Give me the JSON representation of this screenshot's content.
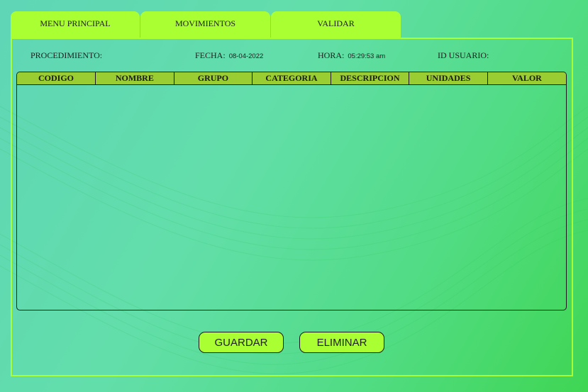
{
  "tabs": [
    {
      "label": "MENU PRINCIPAL"
    },
    {
      "label": "MOVIMIENTOS"
    },
    {
      "label": "VALIDAR"
    }
  ],
  "header_fields": {
    "procedimiento": {
      "label": "PROCEDIMIENTO:",
      "value": ""
    },
    "fecha": {
      "label": "FECHA:",
      "value": "08-04-2022"
    },
    "hora": {
      "label": "HORA:",
      "value": "05:29:53 am"
    },
    "id_usuario": {
      "label": "ID USUARIO:",
      "value": ""
    }
  },
  "table": {
    "columns": [
      "CODIGO",
      "NOMBRE",
      "GRUPO",
      "CATEGORIA",
      "DESCRIPCION",
      "UNIDADES",
      "VALOR"
    ],
    "rows": []
  },
  "buttons": {
    "guardar": "GUARDAR",
    "eliminar": "ELIMINAR"
  },
  "colors": {
    "accent": "#aaff33",
    "table_header": "#9acd32",
    "background_start": "#5fd6b6",
    "background_end": "#3fd653"
  }
}
